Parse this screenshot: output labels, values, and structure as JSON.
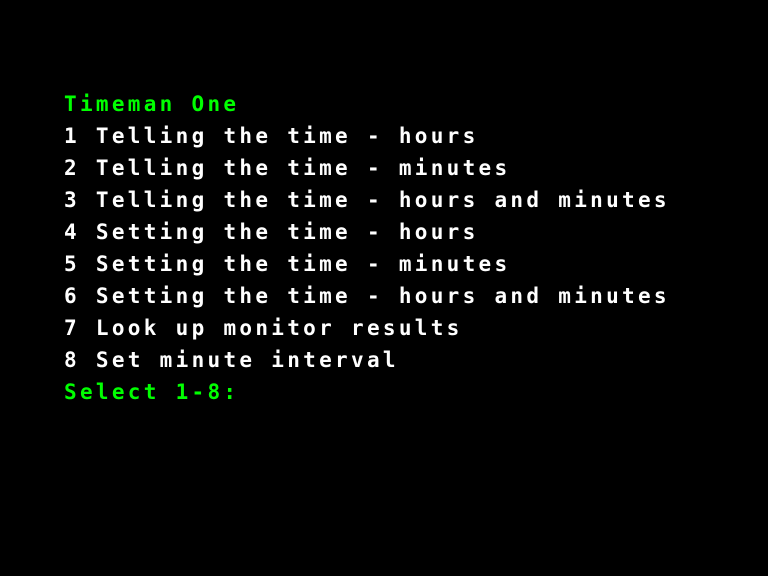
{
  "title": "Timeman One",
  "menu": {
    "items": [
      {
        "number": "1",
        "label": "Telling the time - hours"
      },
      {
        "number": "2",
        "label": "Telling the time - minutes"
      },
      {
        "number": "3",
        "label": "Telling the time - hours and minutes"
      },
      {
        "number": "4",
        "label": "Setting the time - hours"
      },
      {
        "number": "5",
        "label": "Setting the time - minutes"
      },
      {
        "number": "6",
        "label": "Setting the time - hours and minutes"
      },
      {
        "number": "7",
        "label": "Look up monitor results"
      },
      {
        "number": "8",
        "label": "Set minute interval"
      }
    ]
  },
  "prompt": "Select 1-8:",
  "colors": {
    "background": "#000000",
    "highlight": "#00ff00",
    "text": "#ffffff"
  }
}
